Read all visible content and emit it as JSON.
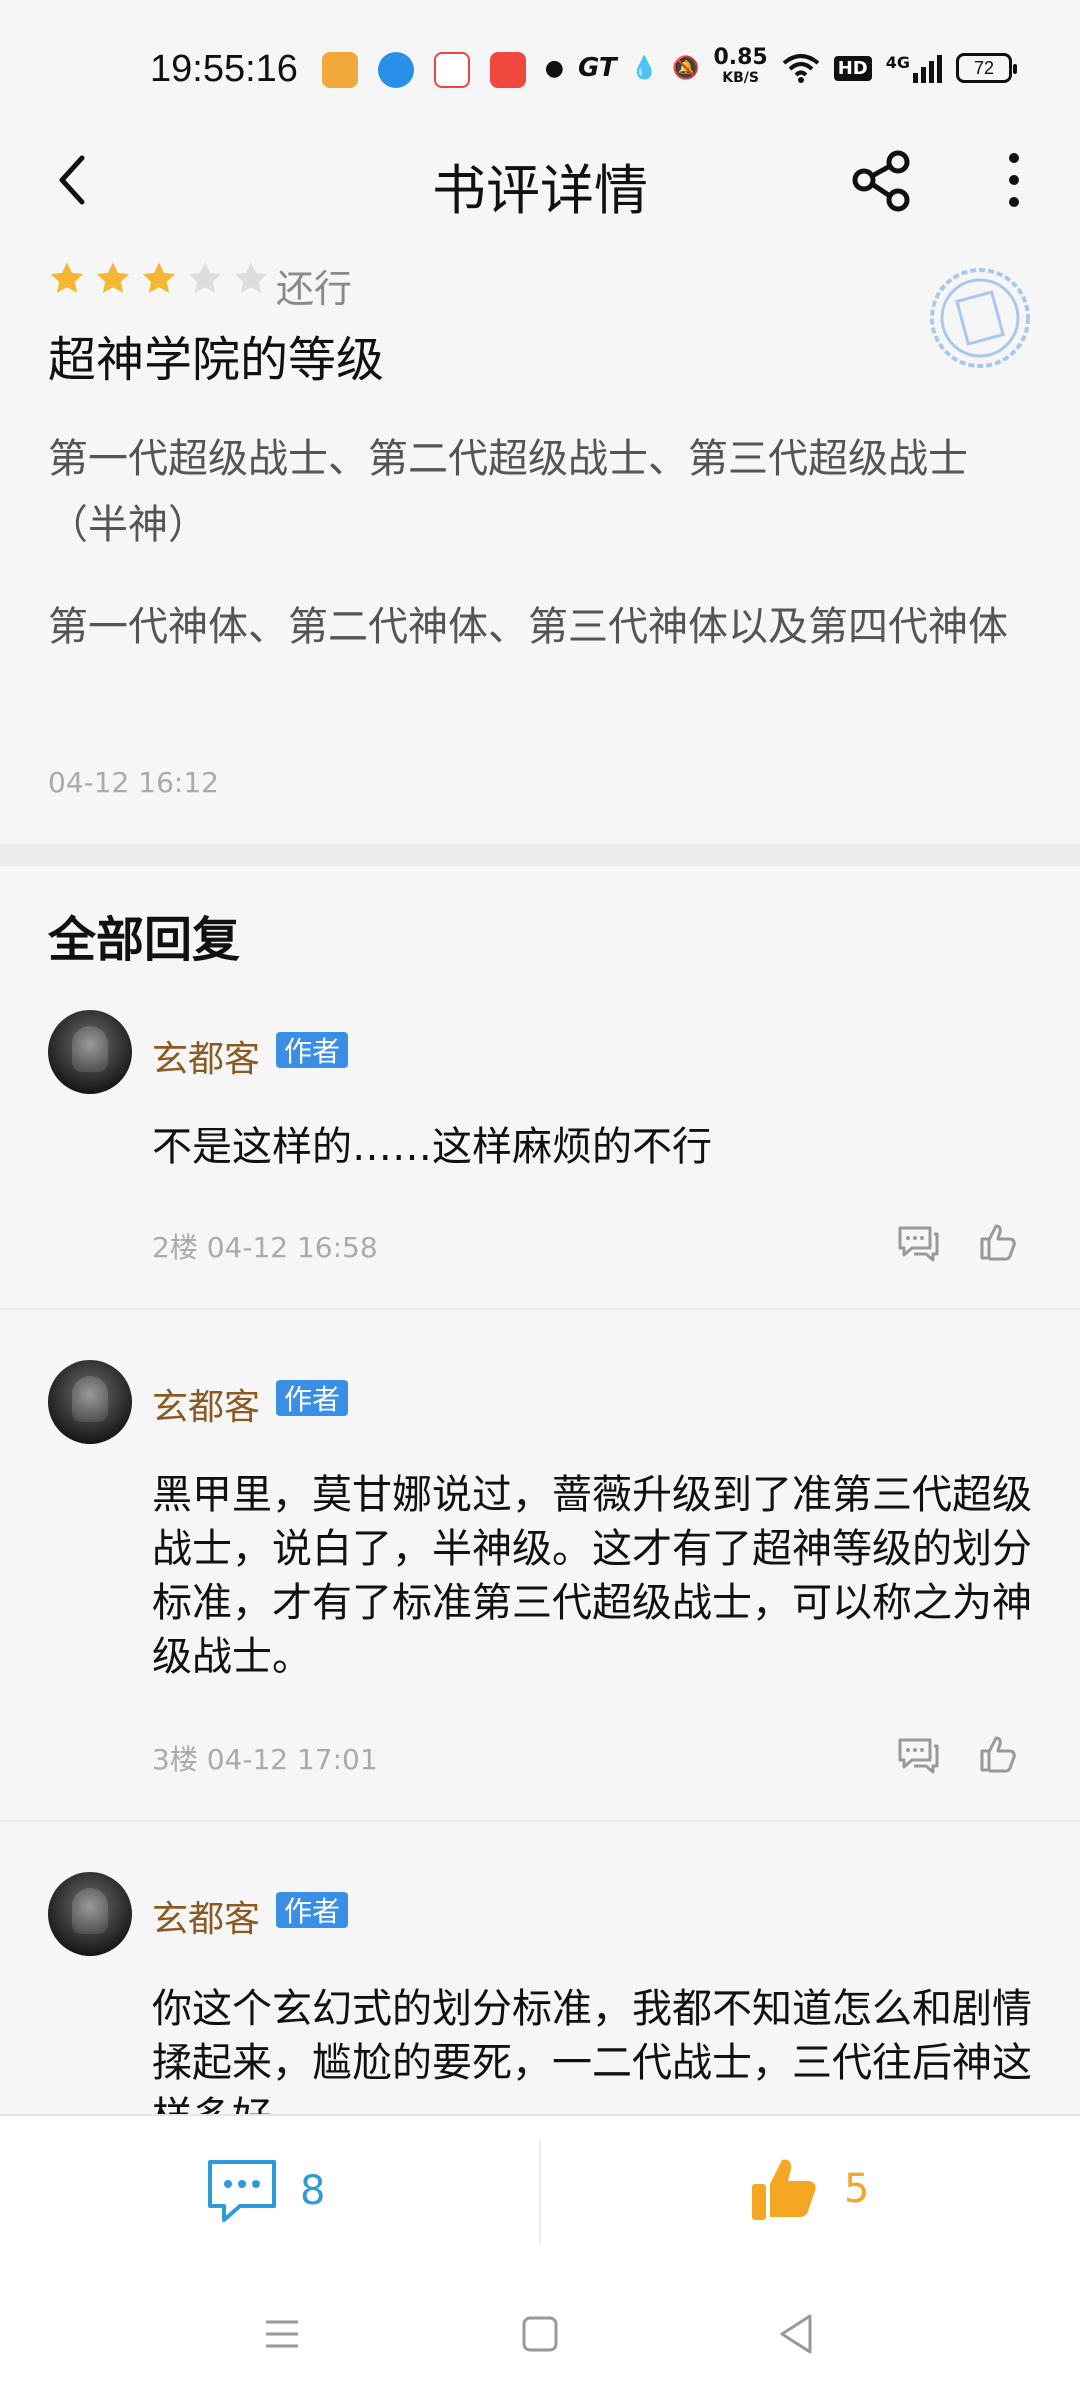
{
  "status_bar": {
    "time": "19:55:16",
    "network_speed_value": "0.85",
    "network_speed_unit": "KB/S",
    "network_type": "4G",
    "hd_label": "HD",
    "battery": "72"
  },
  "header": {
    "title": "书评详情"
  },
  "review": {
    "rating": 3,
    "rating_max": 5,
    "rating_text": "还行",
    "title": "超神学院的等级",
    "paragraph_1": "第一代超级战士、第二代超级战士、第三代超级战士（半神）",
    "paragraph_2": "第一代神体、第二代神体、第三代神体以及第四代神体",
    "time": "04-12 16:12"
  },
  "replies_section": {
    "title": "全部回复",
    "items": [
      {
        "author": "玄都客",
        "badge": "作者",
        "text": "不是这样的……这样麻烦的不行",
        "meta": "2楼 04-12 16:58"
      },
      {
        "author": "玄都客",
        "badge": "作者",
        "text": "黑甲里，莫甘娜说过，蔷薇升级到了准第三代超级战士，说白了，半神级。这才有了超神等级的划分标准，才有了标准第三代超级战士，可以称之为神级战士。",
        "meta": "3楼 04-12 17:01"
      },
      {
        "author": "玄都客",
        "badge": "作者",
        "text": "你这个玄幻式的划分标准，我都不知道怎么和剧情揉起来，尴尬的要死，一二代战士，三代往后神这样多好",
        "meta": ""
      }
    ]
  },
  "action_bar": {
    "comment_count": "8",
    "like_count": "5"
  },
  "colors": {
    "star_on": "#f5b731",
    "star_off": "#dddddd",
    "author_name": "#8b5a23",
    "badge_bg": "#3a8ee6",
    "comment_accent": "#2f9ad8",
    "like_accent": "#f5a623"
  }
}
